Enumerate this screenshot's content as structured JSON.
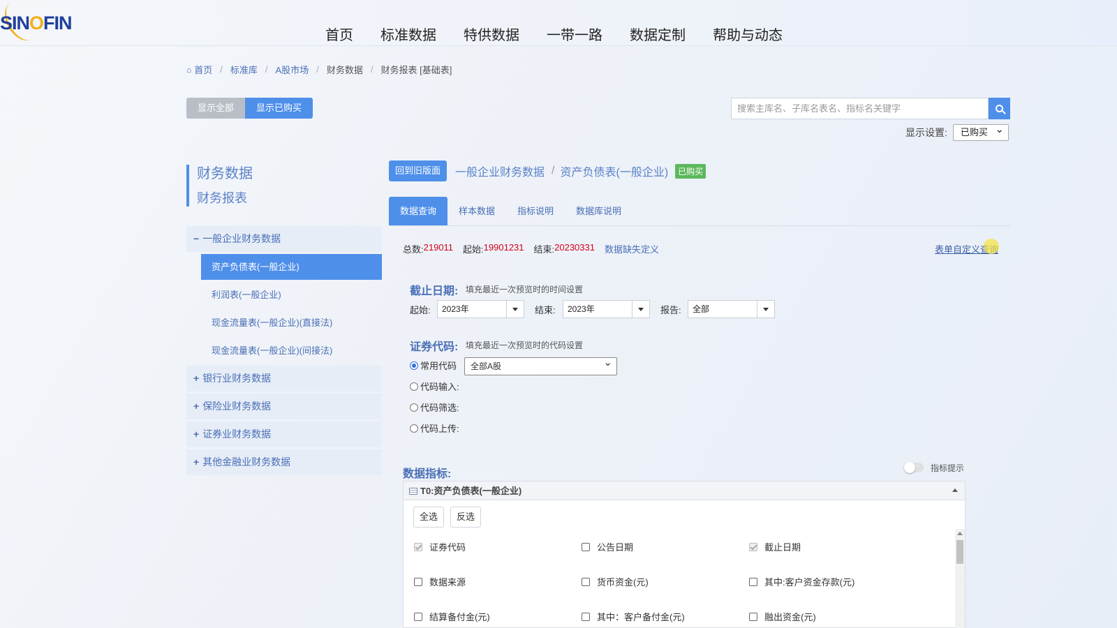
{
  "logo": {
    "left": "SIN",
    "o": "O",
    "right": "FIN"
  },
  "nav": [
    "首页",
    "标准数据",
    "特供数据",
    "一带一路",
    "数据定制",
    "帮助与动态"
  ],
  "breadcrumb": [
    "首页",
    "标准库",
    "A股市场",
    "财务数据",
    "财务报表 [基础表]"
  ],
  "toggle": {
    "all": "显示全部",
    "bought": "显示已购买"
  },
  "search": {
    "placeholder": "搜索主库名、子库名表名、指标名关键字"
  },
  "display": {
    "label": "显示设置:",
    "value": "已购买"
  },
  "sidebar": {
    "title": "财务数据",
    "subtitle": "财务报表",
    "groups": [
      {
        "label": "一般企业财务数据",
        "sign": "−",
        "children": [
          "资产负债表(一般企业)",
          "利润表(一般企业)",
          "现金流量表(一般企业)(直接法)",
          "现金流量表(一般企业)(间接法)"
        ]
      },
      {
        "label": "银行业财务数据",
        "sign": "+"
      },
      {
        "label": "保险业财务数据",
        "sign": "+"
      },
      {
        "label": "证券业财务数据",
        "sign": "+"
      },
      {
        "label": "其他金融业财务数据",
        "sign": "+"
      }
    ]
  },
  "header": {
    "old_button": "回到旧版面",
    "crumb1": "一般企业财务数据",
    "sep": "/",
    "crumb2": "资产负债表(一般企业)",
    "badge": "已购买"
  },
  "tabs": [
    "数据查询",
    "样本数据",
    "指标说明",
    "数据库说明"
  ],
  "stats": {
    "total_label": "总数:",
    "total": "219011",
    "start_label": "起始:",
    "start": "19901231",
    "end_label": "结束:",
    "end": "20230331",
    "missing_link": "数据缺失定义",
    "custom_query": "表单自定义查询"
  },
  "date_section": {
    "title": "截止日期:",
    "hint": "填充最近一次预览时的时间设置",
    "start_label": "起始:",
    "start_value": "2023年",
    "end_label": "结束:",
    "end_value": "2023年",
    "report_label": "报告:",
    "report_value": "全部"
  },
  "code_section": {
    "title": "证券代码:",
    "hint": "填充最近一次预览时的代码设置",
    "options": [
      "常用代码",
      "代码输入:",
      "代码筛选:",
      "代码上传:"
    ],
    "common_value": "全部A股"
  },
  "indicators": {
    "title": "数据指标:",
    "toggle_label": "指标提示",
    "table_name": "T0:资产负债表(一般企业)",
    "select_all": "全选",
    "invert": "反选",
    "fields": [
      [
        "证券代码",
        "公告日期",
        "截止日期"
      ],
      [
        "数据来源",
        "货币资金(元)",
        "其中:客户资金存款(元)"
      ],
      [
        "结算备付金(元)",
        "其中：客户备付金(元)",
        "融出资金(元)"
      ]
    ]
  }
}
